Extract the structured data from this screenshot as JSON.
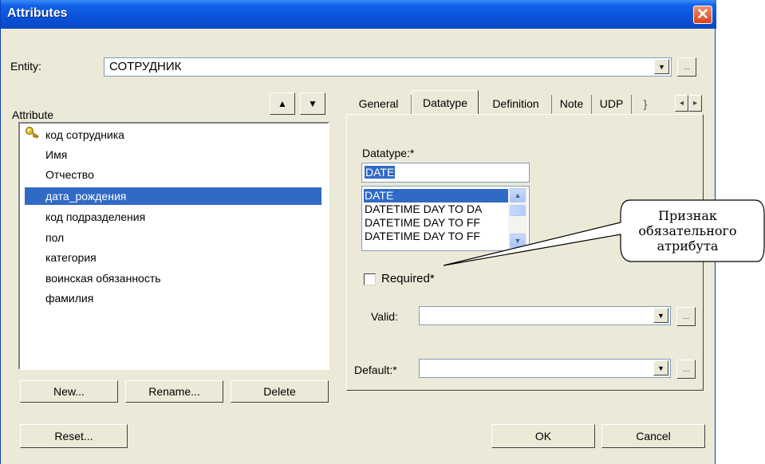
{
  "window": {
    "title": "Attributes",
    "close": "✕"
  },
  "entity": {
    "label": "Entity:",
    "value": "СОТРУДНИК",
    "more": "..."
  },
  "attributes": {
    "label": "Attribute",
    "up": "▲",
    "down": "▼",
    "items": [
      "код сотрудника",
      "Имя",
      "Отчество",
      "дата_рождения",
      "код подразделения",
      "пол",
      "категория",
      "воинская обязанность",
      "фамилия"
    ],
    "selected_index": 3
  },
  "buttons": {
    "new": "New...",
    "rename": "Rename...",
    "delete": "Delete",
    "reset": "Reset...",
    "ok": "OK",
    "cancel": "Cancel"
  },
  "tabs": [
    "General",
    "Datatype",
    "Definition",
    "Note",
    "UDP",
    "}"
  ],
  "active_tab": "Datatype",
  "tab_scroll": {
    "left": "◂",
    "right": "▸"
  },
  "datatype": {
    "label": "Datatype:*",
    "value": "DATE",
    "options": [
      "DATE",
      "DATETIME DAY TO DA",
      "DATETIME DAY TO FF",
      "DATETIME DAY TO FF"
    ],
    "selected_index": 0
  },
  "required": {
    "label": "Required*",
    "checked": false
  },
  "valid": {
    "label": "Valid:",
    "value": "",
    "more": "..."
  },
  "default": {
    "label": "Default:*",
    "value": "",
    "more": "..."
  },
  "callout": {
    "line1": "Признак",
    "line2": "обязательного",
    "line3": "атрибута"
  }
}
